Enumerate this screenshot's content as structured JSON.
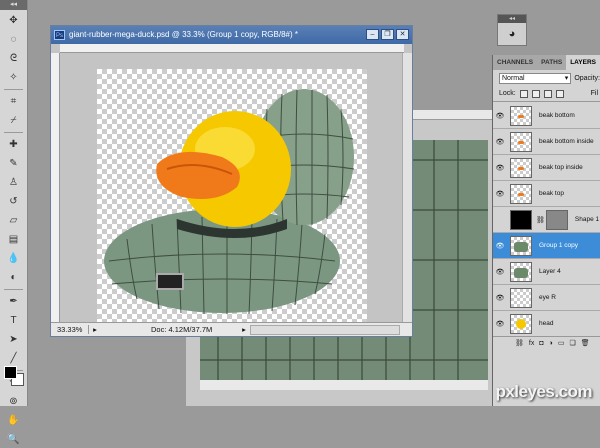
{
  "document": {
    "title": "giant-rubber-mega-duck.psd @ 33.3% (Group 1 copy, RGB/8#) *",
    "app_badge": "Ps",
    "zoom": "33.33%",
    "doc_info": "Doc: 4.12M/37.7M"
  },
  "panel": {
    "tabs": [
      "CHANNELS",
      "PATHS",
      "LAYERS"
    ],
    "active_tab": "LAYERS",
    "blend_mode": "Normal",
    "opacity_label": "Opacity:",
    "lock_label": "Lock:",
    "fill_label": "Fil",
    "layers": [
      {
        "name": "beak bottom",
        "visible": true,
        "selected": false,
        "thumb": "orange-bit"
      },
      {
        "name": "beak bottom inside",
        "visible": true,
        "selected": false,
        "thumb": "orange-bit"
      },
      {
        "name": "beak top inside",
        "visible": true,
        "selected": false,
        "thumb": "orange-bit"
      },
      {
        "name": "beak top",
        "visible": true,
        "selected": false,
        "thumb": "orange-bit"
      },
      {
        "name": "Shape 1",
        "visible": false,
        "selected": false,
        "thumb": "mask"
      },
      {
        "name": "Group 1 copy",
        "visible": true,
        "selected": true,
        "thumb": "green"
      },
      {
        "name": "Layer 4",
        "visible": true,
        "selected": false,
        "thumb": "green"
      },
      {
        "name": "eye R",
        "visible": true,
        "selected": false,
        "thumb": "empty"
      },
      {
        "name": "head",
        "visible": true,
        "selected": false,
        "thumb": "yellow"
      }
    ]
  },
  "colors": {
    "selected_layer": "#3c8cd8",
    "title_bar": "#4a74ae",
    "duck_yellow": "#f5c800",
    "beak_orange": "#f07a1a",
    "wood_green": "#7f9a84"
  },
  "watermark": "pxleyes.com"
}
